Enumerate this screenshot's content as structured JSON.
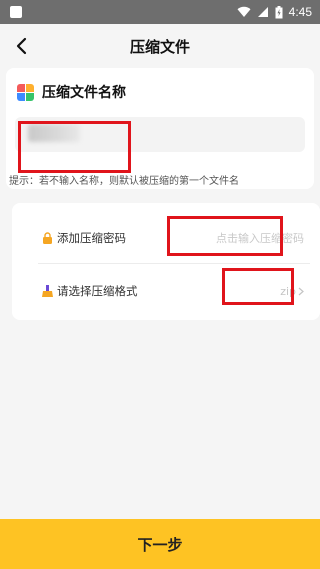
{
  "status_bar": {
    "time": "4:45"
  },
  "nav": {
    "title": "压缩文件"
  },
  "name_card": {
    "title": "压缩文件名称",
    "input_value": "",
    "hint": "提示：若不输入名称，则默认被压缩的第一个文件名"
  },
  "options": {
    "password": {
      "label": "添加压缩密码",
      "placeholder": "点击输入压缩密码"
    },
    "format": {
      "label": "请选择压缩格式",
      "value": "zip"
    }
  },
  "footer": {
    "next_label": "下一步"
  },
  "colors": {
    "accent": "#fec323",
    "annotation": "#e0141b",
    "page_bg": "#f5f5f5"
  }
}
